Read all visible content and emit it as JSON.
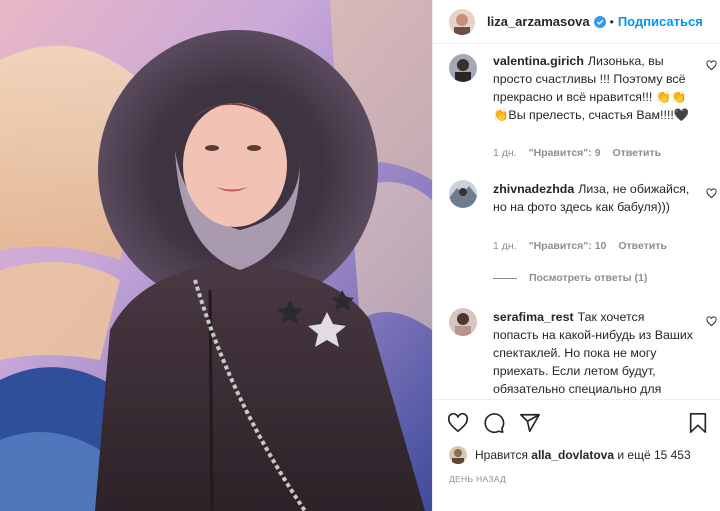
{
  "header": {
    "username": "liza_arzamasova",
    "separator": "•",
    "follow_label": "Подписаться"
  },
  "comments": [
    {
      "username": "valentina.girich",
      "text": "Лизонька, вы просто счастливы !!! Поэтому всё прекрасно и всё нравится!!! 👏👏👏Вы прелесть, счастья Вам!!!!🖤",
      "time": "1 дн.",
      "likes": "\"Нравится\": 9",
      "reply": "Ответить"
    },
    {
      "username": "zhivnadezhda",
      "text": "Лиза, не обижайся, но на фото здесь как бабуля)))",
      "time": "1 дн.",
      "likes": "\"Нравится\": 10",
      "reply": "Ответить",
      "view_replies": "Посмотреть ответы (1)"
    },
    {
      "username": "serafima_rest",
      "text": "Так хочется попасть на какой-нибудь из Ваших спектаклей. Но пока не могу приехать. Если летом будут, обязательно специально для этого приеду в Москву 🎀"
    }
  ],
  "actions": {
    "like_icon": "heart-icon",
    "comment_icon": "comment-icon",
    "share_icon": "share-icon",
    "save_icon": "bookmark-icon"
  },
  "likes": {
    "prefix": "Нравится",
    "user": "alla_dovlatova",
    "suffix": "и ещё 15 453"
  },
  "time_ago": "ДЕНЬ НАЗАД",
  "colors": {
    "accent": "#0095f6",
    "verified": "#3897f0",
    "muted": "#8e8e8e",
    "text": "#262626"
  }
}
